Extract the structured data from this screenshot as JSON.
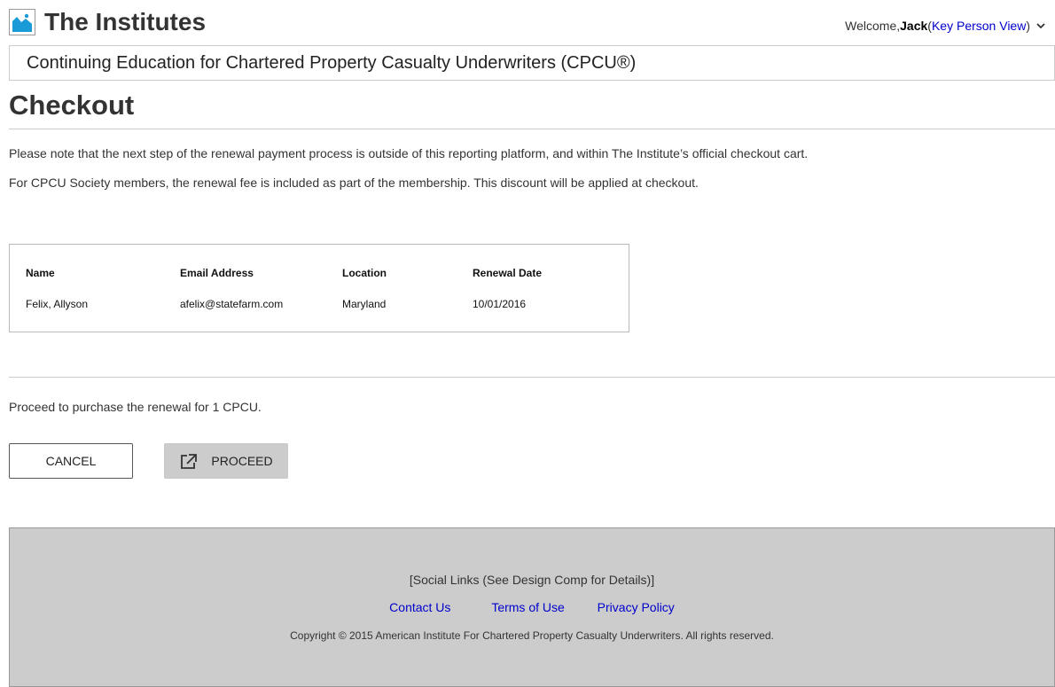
{
  "header": {
    "brand": "The Institutes",
    "logo_icon": "image-placeholder-icon",
    "welcome_prefix": "Welcome, ",
    "user_name": "Jack",
    "paren_open": " (",
    "view_link": "Key Person View",
    "paren_close": ")",
    "dropdown_icon": "chevron-down-icon"
  },
  "subheader": {
    "title": "Continuing Education for Chartered Property Casualty Underwriters (CPCU®)"
  },
  "page": {
    "title": "Checkout",
    "note1": "Please note that the next step of the renewal payment process is outside of this reporting platform, and within The Institute’s official checkout cart.",
    "note2": "For CPCU Society members, the renewal fee is included as part of the membership. This discount will be applied at checkout."
  },
  "table": {
    "columns": [
      "Name",
      "Email Address",
      "Location",
      "Renewal Date"
    ],
    "rows": [
      [
        "Felix, Allyson",
        "afelix@statefarm.com",
        "Maryland",
        "10/01/2016"
      ]
    ]
  },
  "purchase": {
    "message": "Proceed to purchase the renewal for 1 CPCU.",
    "cancel_label": "CANCEL",
    "proceed_label": "PROCEED",
    "proceed_icon": "external-link-icon"
  },
  "footer": {
    "social": "[Social Links (See Design Comp for Details)]",
    "links": [
      "Contact Us",
      "Terms of Use",
      "Privacy Policy"
    ],
    "copyright": "Copyright © 2015 American Institute For Chartered Property Casualty Underwriters. All rights reserved."
  },
  "colors": {
    "link": "#0000cc",
    "logo_accent": "#1a9ad6",
    "footer_bg": "#cccccc",
    "proceed_bg": "#cccccc"
  }
}
